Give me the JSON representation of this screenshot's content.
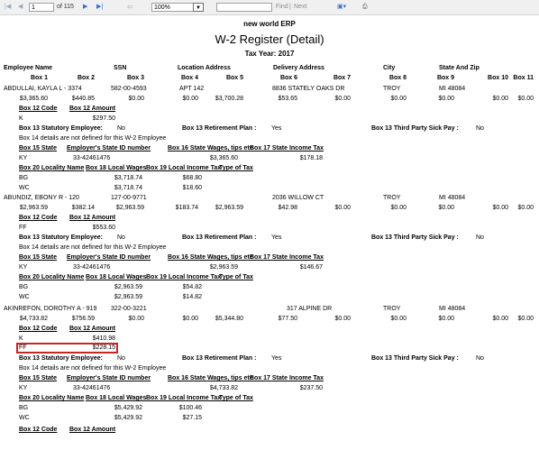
{
  "toolbar": {
    "page_value": "1",
    "page_of": "of 115",
    "zoom": "100%",
    "find_value": "",
    "find_label": "Find",
    "separator": "|",
    "next_label": "Next"
  },
  "report": {
    "company": "new world ERP",
    "title": "W-2 Register (Detail)",
    "tax_year": "Tax Year: 2017"
  },
  "headers": {
    "row1": {
      "employee_name": "Employee Name",
      "ssn": "SSN",
      "location_address": "Location Address",
      "delivery_address": "Delivery Address",
      "city": "City",
      "state_zip": "State And Zip"
    },
    "row2": [
      "Box 1",
      "Box 2",
      "Box 3",
      "Box 4",
      "Box 5",
      "Box 6",
      "Box 7",
      "Box 8",
      "Box 9",
      "Box 10",
      "Box 11"
    ]
  },
  "labels": {
    "box12_code": "Box 12 Code",
    "box12_amount": "Box 12 Amount",
    "box13_statutory": "Box 13 Statutory  Employee:",
    "box13_retirement": "Box 13 Retirement Plan :",
    "box13_sick": "Box 13 Third Party Sick Pay :",
    "box14_none": "Box 14 details are not defined for this W-2 Employee",
    "box15_state": "Box 15 State",
    "employer_state_id": "Employer's State ID number",
    "box16": "Box 16 State Wages, tips etc",
    "box17": "Box 17 State Income Tax",
    "box20": "Box 20 Locality Name",
    "box18": "Box 18 Local Wages",
    "box19": "Box 19 Local Income Tax",
    "type_of_tax": "Type of Tax"
  },
  "employees": [
    {
      "name": "ABDULLAI, KAYLA L - 3374",
      "ssn": "582-00-4593",
      "location": "APT 142",
      "delivery": "8836 STATELY OAKS DR",
      "city": "TROY",
      "state_zip": "MI 48084",
      "boxes": [
        "$3,365.60",
        "$440.85",
        "$0.00",
        "$0.00",
        "$3,700.28",
        "$53.65",
        "$0.00",
        "$0.00",
        "$0.00",
        "$0.00",
        "$0.00"
      ],
      "box12": [
        {
          "code": "K",
          "amount": "$297.50"
        }
      ],
      "statutory": "No",
      "retirement": "Yes",
      "sick_pay": "No",
      "state": {
        "state": "KY",
        "id": "33-42461476",
        "wages": "$3,365.60",
        "tax": "$178.18"
      },
      "localities": [
        {
          "name": "BG",
          "wages": "$3,718.74",
          "tax": "$68.80"
        },
        {
          "name": "WC",
          "wages": "$3,718.74",
          "tax": "$18.60"
        }
      ]
    },
    {
      "name": "ABUNDIZ, EBONY R - 120",
      "ssn": "127-00-9771",
      "location": "",
      "delivery": "2036 WILLOW CT",
      "city": "TROY",
      "state_zip": "MI 48084",
      "boxes": [
        "$2,963.59",
        "$382.14",
        "$2,963.59",
        "$183.74",
        "$2,963.59",
        "$42.98",
        "$0.00",
        "$0.00",
        "$0.00",
        "$0.00",
        "$0.00"
      ],
      "box12": [
        {
          "code": "FF",
          "amount": "$553.60"
        }
      ],
      "statutory": "No",
      "retirement": "Yes",
      "sick_pay": "No",
      "state": {
        "state": "KY",
        "id": "33-42461476",
        "wages": "$2,963.59",
        "tax": "$146.67"
      },
      "localities": [
        {
          "name": "BG",
          "wages": "$2,963.59",
          "tax": "$54.82"
        },
        {
          "name": "WC",
          "wages": "$2,963.59",
          "tax": "$14.82"
        }
      ]
    },
    {
      "name": "AKINREFON, DOROTHY A - 919",
      "ssn": "322-00-3221",
      "location": "",
      "delivery": "317 ALPINE DR",
      "city": "TROY",
      "state_zip": "MI 48084",
      "boxes": [
        "$4,733.82",
        "$756.59",
        "$0.00",
        "$0.00",
        "$5,344.80",
        "$77.50",
        "$0.00",
        "$0.00",
        "$0.00",
        "$0.00",
        "$0.00"
      ],
      "box12": [
        {
          "code": "K",
          "amount": "$410.98"
        },
        {
          "code": "FF",
          "amount": "$228.15"
        }
      ],
      "statutory": "No",
      "retirement": "Yes",
      "sick_pay": "No",
      "state": {
        "state": "KY",
        "id": "33-42461476",
        "wages": "$4,733.82",
        "tax": "$237.50"
      },
      "localities": [
        {
          "name": "BG",
          "wages": "$5,429.92",
          "tax": "$100.46"
        },
        {
          "name": "WC",
          "wages": "$5,429.92",
          "tax": "$27.15"
        }
      ]
    }
  ],
  "trailing_labels": {
    "box12_code": "Box 12 Code",
    "box12_amount": "Box 12 Amount"
  },
  "highlight": {
    "color": "#c62828"
  },
  "icons": [
    "first-page-icon",
    "prev-page-icon",
    "next-page-icon",
    "last-page-icon",
    "back-icon",
    "export-icon",
    "print-icon"
  ]
}
